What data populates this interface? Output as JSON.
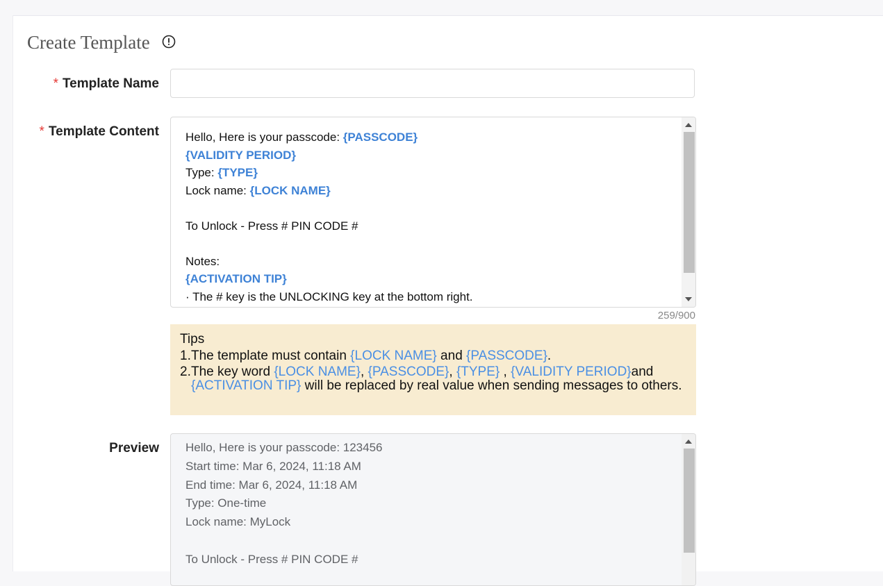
{
  "page": {
    "title": "Create Template",
    "info_icon": "info-circle-icon"
  },
  "form": {
    "name_label": "Template Name",
    "name_value": "",
    "name_placeholder": "",
    "content_label": "Template Content",
    "required_mark": "*",
    "content_lines": [
      [
        {
          "t": "Hello, Here is your passcode:  "
        },
        {
          "t": "{PASSCODE}",
          "kw": true
        }
      ],
      [
        {
          "t": "{VALIDITY PERIOD}",
          "kw": true
        }
      ],
      [
        {
          "t": "Type: "
        },
        {
          "t": "{TYPE}",
          "kw": true
        }
      ],
      [
        {
          "t": "Lock name: "
        },
        {
          "t": "{LOCK NAME}",
          "kw": true
        }
      ],
      [
        {
          "t": ""
        }
      ],
      [
        {
          "t": "To Unlock - Press # PIN CODE #"
        }
      ],
      [
        {
          "t": ""
        }
      ],
      [
        {
          "t": "Notes:"
        }
      ],
      [
        {
          "t": "{ACTIVATION TIP}",
          "kw": true
        }
      ],
      [
        {
          "t": "· The # key is the UNLOCKING key at the bottom right."
        }
      ]
    ],
    "counter": "259/900",
    "preview_label": "Preview",
    "preview_lines": [
      "Hello, Here is your passcode:  123456",
      "Start time: Mar 6, 2024, 11:18 AM",
      "End time: Mar 6, 2024, 11:18 AM",
      "Type: One-time",
      "Lock name: MyLock",
      "",
      "To Unlock - Press # PIN CODE #"
    ]
  },
  "tips": {
    "title": "Tips",
    "items": [
      {
        "num": "1.",
        "parts": [
          {
            "t": "The template must contain "
          },
          {
            "t": "{LOCK NAME}",
            "kw": true
          },
          {
            "t": " and "
          },
          {
            "t": "{PASSCODE}",
            "kw": true
          },
          {
            "t": "."
          }
        ]
      },
      {
        "num": "2.",
        "parts": [
          {
            "t": "The key word "
          },
          {
            "t": "{LOCK NAME}",
            "kw": true
          },
          {
            "t": ", "
          },
          {
            "t": "{PASSCODE}",
            "kw": true
          },
          {
            "t": ", "
          },
          {
            "t": "{TYPE}",
            "kw": true
          },
          {
            "t": " , "
          },
          {
            "t": "{VALIDITY PERIOD}",
            "kw": true
          },
          {
            "t": "and "
          },
          {
            "t": "{ACTIVATION TIP}",
            "kw": true
          },
          {
            "t": " will be replaced by real value when sending messages to others."
          }
        ]
      }
    ]
  },
  "colors": {
    "keyword": "#3e82d6",
    "tips_bg": "#f8ecd1",
    "required": "#e53935"
  }
}
